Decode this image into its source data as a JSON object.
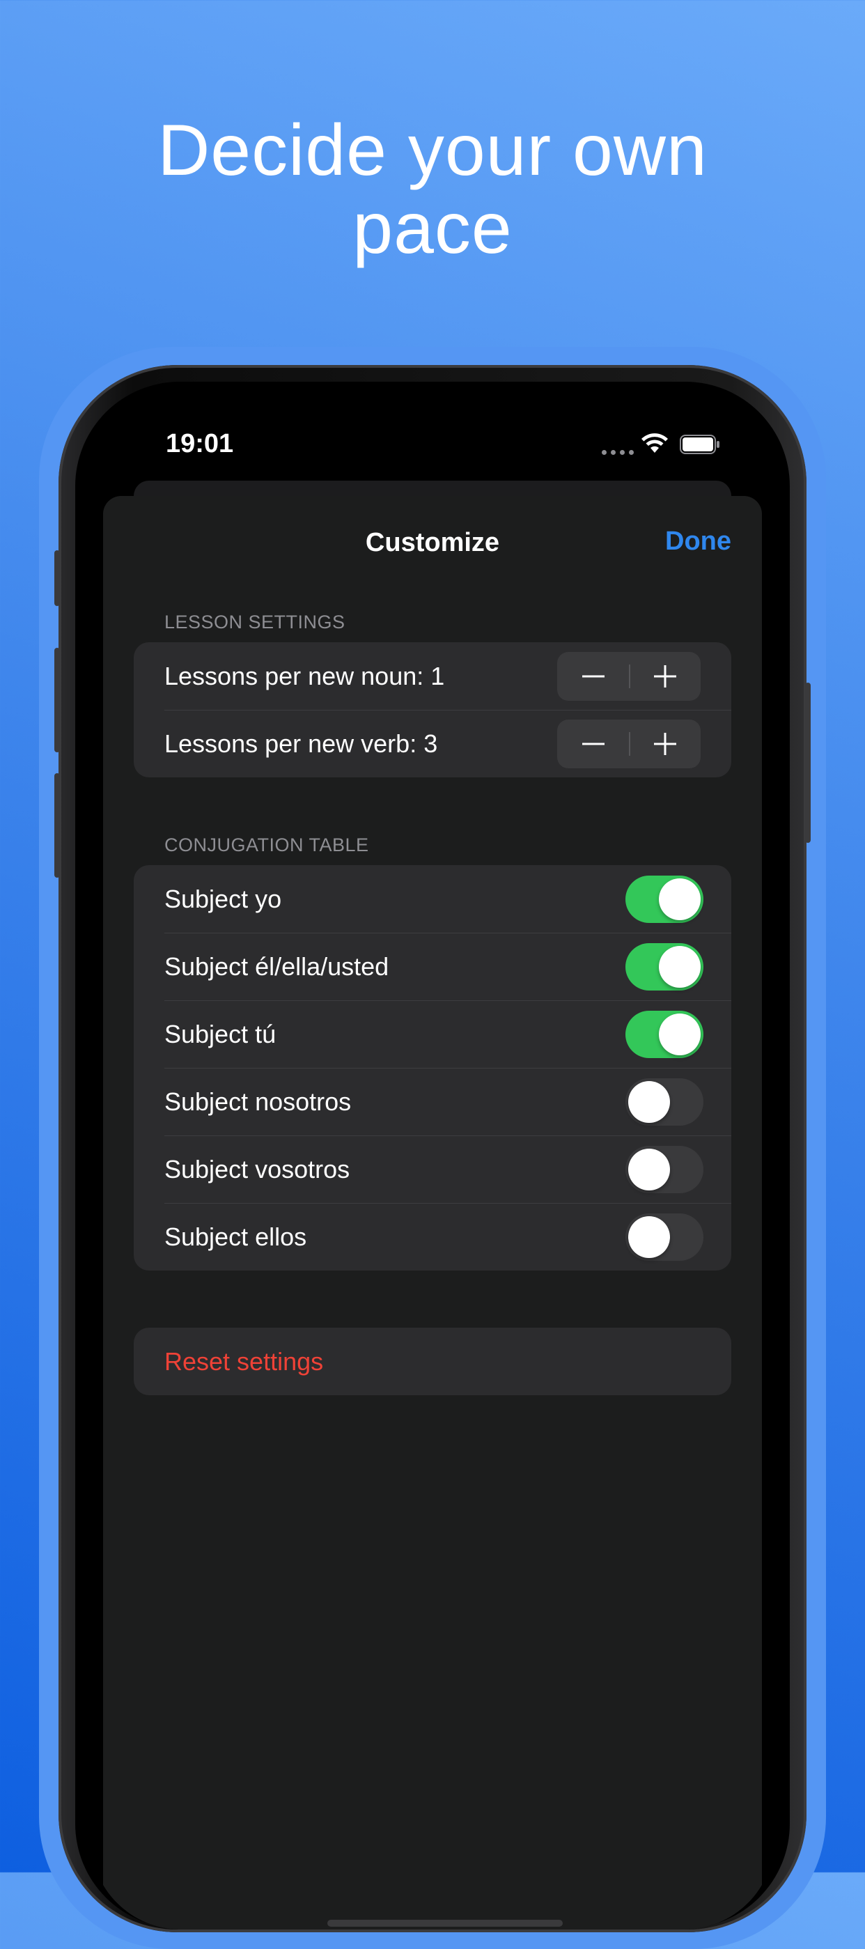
{
  "headline": {
    "line1": "Decide your own",
    "line2": "pace"
  },
  "status_bar": {
    "time": "19:01",
    "icons": [
      "signal-dots-icon",
      "wifi-icon",
      "battery-icon"
    ]
  },
  "sheet": {
    "title": "Customize",
    "done_label": "Done"
  },
  "lesson_settings": {
    "header": "LESSON SETTINGS",
    "rows": [
      {
        "label": "Lessons per new noun: 1",
        "minus": "−",
        "plus": "+"
      },
      {
        "label": "Lessons per new verb: 3",
        "minus": "−",
        "plus": "+"
      }
    ]
  },
  "conjugation_table": {
    "header": "CONJUGATION TABLE",
    "rows": [
      {
        "label": "Subject yo",
        "on": true
      },
      {
        "label": "Subject él/ella/usted",
        "on": true
      },
      {
        "label": "Subject tú",
        "on": true
      },
      {
        "label": "Subject nosotros",
        "on": false
      },
      {
        "label": "Subject vosotros",
        "on": false
      },
      {
        "label": "Subject ellos",
        "on": false
      }
    ]
  },
  "reset": {
    "label": "Reset settings"
  },
  "colors": {
    "accent_blue": "#2f87ee",
    "toggle_on": "#33c759",
    "destructive": "#ef4237",
    "sheet_bg": "#1c1d1d",
    "cell_bg": "#2c2c2e"
  }
}
